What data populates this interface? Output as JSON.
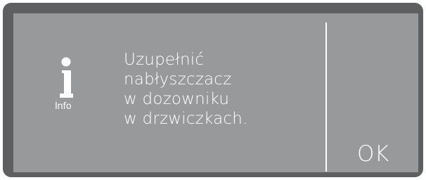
{
  "dialog": {
    "icon": "info-icon",
    "icon_label": "Info",
    "message_lines": [
      "Uzupełnić",
      "nabłyszczacz",
      "w dozowniku",
      "w drzwiczkach."
    ],
    "ok_label": "OK"
  },
  "colors": {
    "bezel": "#5e5f61",
    "screen": "#98999b",
    "foreground": "#ffffff"
  }
}
